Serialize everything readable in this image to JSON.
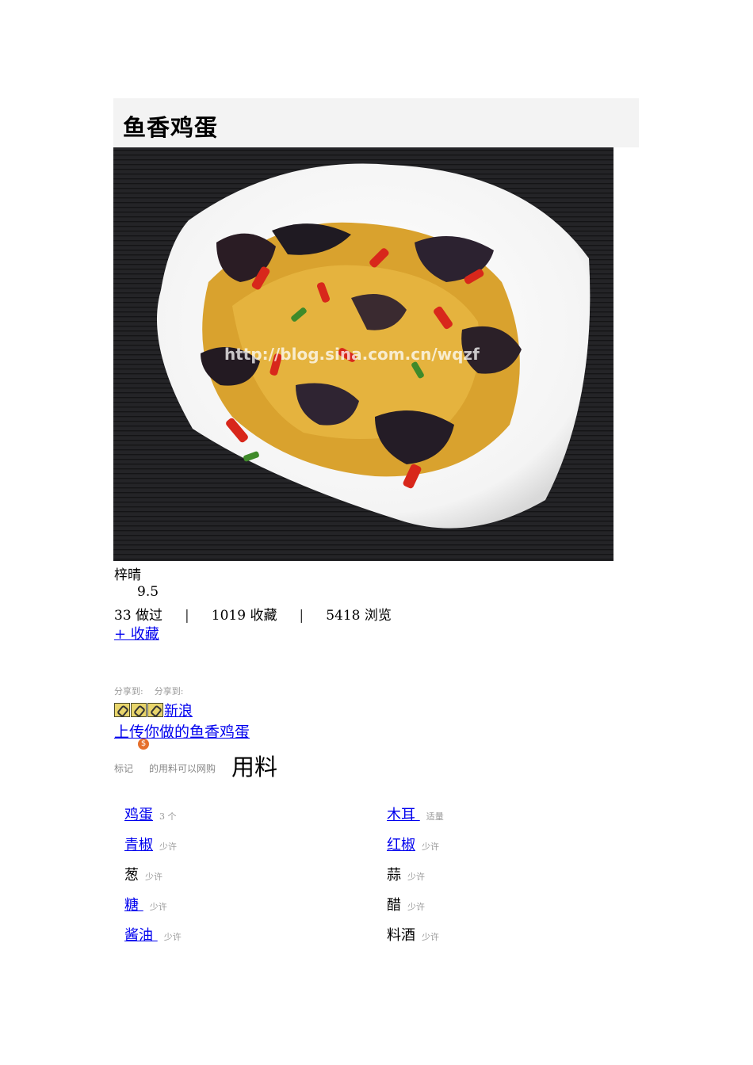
{
  "recipe": {
    "title": "鱼香鸡蛋",
    "author": "梓晴",
    "rating": "9.5",
    "made": "33 做过",
    "favorites": "1019 收藏",
    "views": "5418 浏览",
    "separator": "|",
    "favorite_link": "+ 收藏"
  },
  "share": {
    "label_1": "分享到:",
    "label_2": "分享到:",
    "sina": "新浪",
    "icons": [
      "share-icon",
      "share-icon",
      "share-icon"
    ]
  },
  "upload_link": "上传你做的鱼香鸡蛋",
  "coin_icon": "$",
  "mark_note": {
    "part1": "标记",
    "part2": "的用料可以网购"
  },
  "ingredients_heading": "用料",
  "photo_watermark": "http://blog.sina.com.cn/wqzf",
  "ingredients": [
    {
      "name": "鸡蛋",
      "qty": "3 个",
      "link": true
    },
    {
      "name": "木耳 ",
      "qty": "适量",
      "link": true
    },
    {
      "name": "青椒",
      "qty": "少许",
      "link": true
    },
    {
      "name": "红椒",
      "qty": "少许",
      "link": true
    },
    {
      "name": "葱",
      "qty": "少许",
      "link": false
    },
    {
      "name": "蒜",
      "qty": "少许",
      "link": false
    },
    {
      "name": "糖 ",
      "qty": "少许",
      "link": true
    },
    {
      "name": "醋",
      "qty": "少许",
      "link": false
    },
    {
      "name": "酱油 ",
      "qty": "少许",
      "link": true
    },
    {
      "name": "料酒",
      "qty": "少许",
      "link": false
    }
  ]
}
